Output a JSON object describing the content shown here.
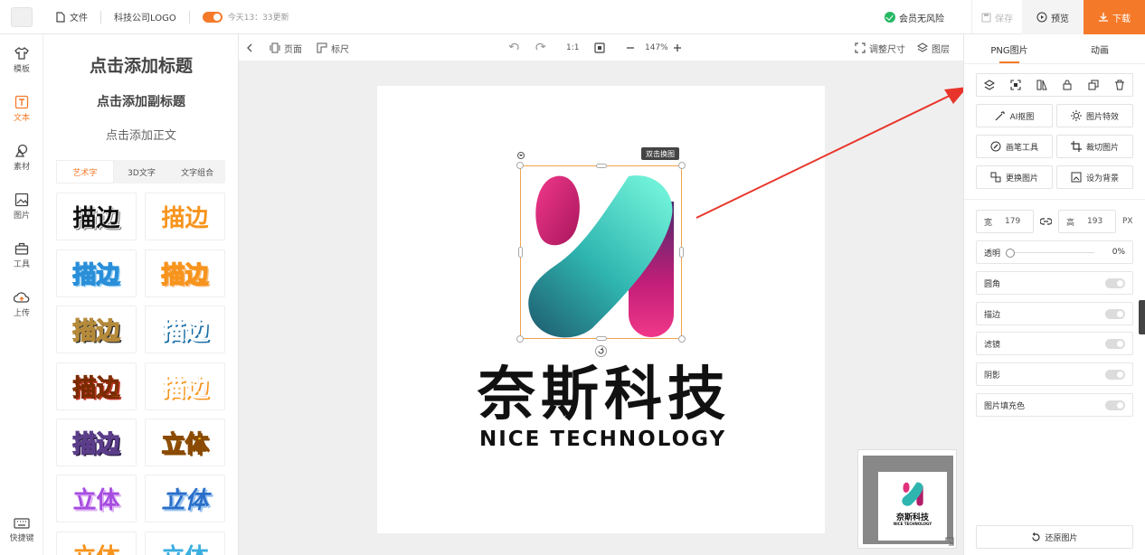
{
  "topbar": {
    "file_label": "文件",
    "project_name": "科技公司LOGO",
    "update_text": "今天13：33更新",
    "member_status": "会员无风险",
    "save_label": "保存",
    "preview_label": "预览",
    "download_label": "下载"
  },
  "iconbar": {
    "items": [
      {
        "label": "模板",
        "icon": "shirt-icon"
      },
      {
        "label": "文本",
        "icon": "text-icon"
      },
      {
        "label": "素材",
        "icon": "shapes-icon"
      },
      {
        "label": "图片",
        "icon": "image-icon"
      },
      {
        "label": "工具",
        "icon": "toolbox-icon"
      },
      {
        "label": "上传",
        "icon": "cloud-upload-icon"
      }
    ],
    "shortcut_label": "快捷键"
  },
  "textpanel": {
    "add_title": "点击添加标题",
    "add_subtitle": "点击添加副标题",
    "add_body": "点击添加正文",
    "tabs": [
      "艺术字",
      "3D文字",
      "文字组合"
    ],
    "swatches": [
      "描边",
      "描边",
      "描边",
      "描边",
      "描边",
      "描边",
      "描边",
      "描边",
      "描边",
      "立体",
      "立体",
      "立体",
      "立体",
      "立体"
    ]
  },
  "canvas_toolbar": {
    "page_label": "页面",
    "ruler_label": "标尺",
    "ratio_label": "1:1",
    "zoom": "147%",
    "resize_label": "调整尺寸",
    "layers_label": "图层"
  },
  "canvas": {
    "tooltip": "双击换图",
    "brand_cn": "奈斯科技",
    "brand_en": "NICE TECHNOLOGY",
    "mini_cn": "奈斯科技",
    "mini_en": "NICE TECHNOLOGY"
  },
  "rightpanel": {
    "tabs": [
      "PNG图片",
      "动画"
    ],
    "buttons": [
      "AI抠图",
      "图片特效",
      "画笔工具",
      "裁切图片",
      "更换图片",
      "设为背景"
    ],
    "width_label": "宽",
    "width_value": "179",
    "height_label": "高",
    "height_value": "193",
    "unit": "PX",
    "opacity_label": "透明",
    "opacity_value": "0%",
    "toggles": [
      "圆角",
      "描边",
      "滤镜",
      "阴影",
      "图片填充色"
    ],
    "restore_label": "还原图片"
  },
  "colors": {
    "accent": "#f47a2a",
    "selection": "#f1a34b",
    "arrow": "#e8352b",
    "logo_pink": "#e2307e",
    "logo_teal": "#2fb5b0"
  }
}
